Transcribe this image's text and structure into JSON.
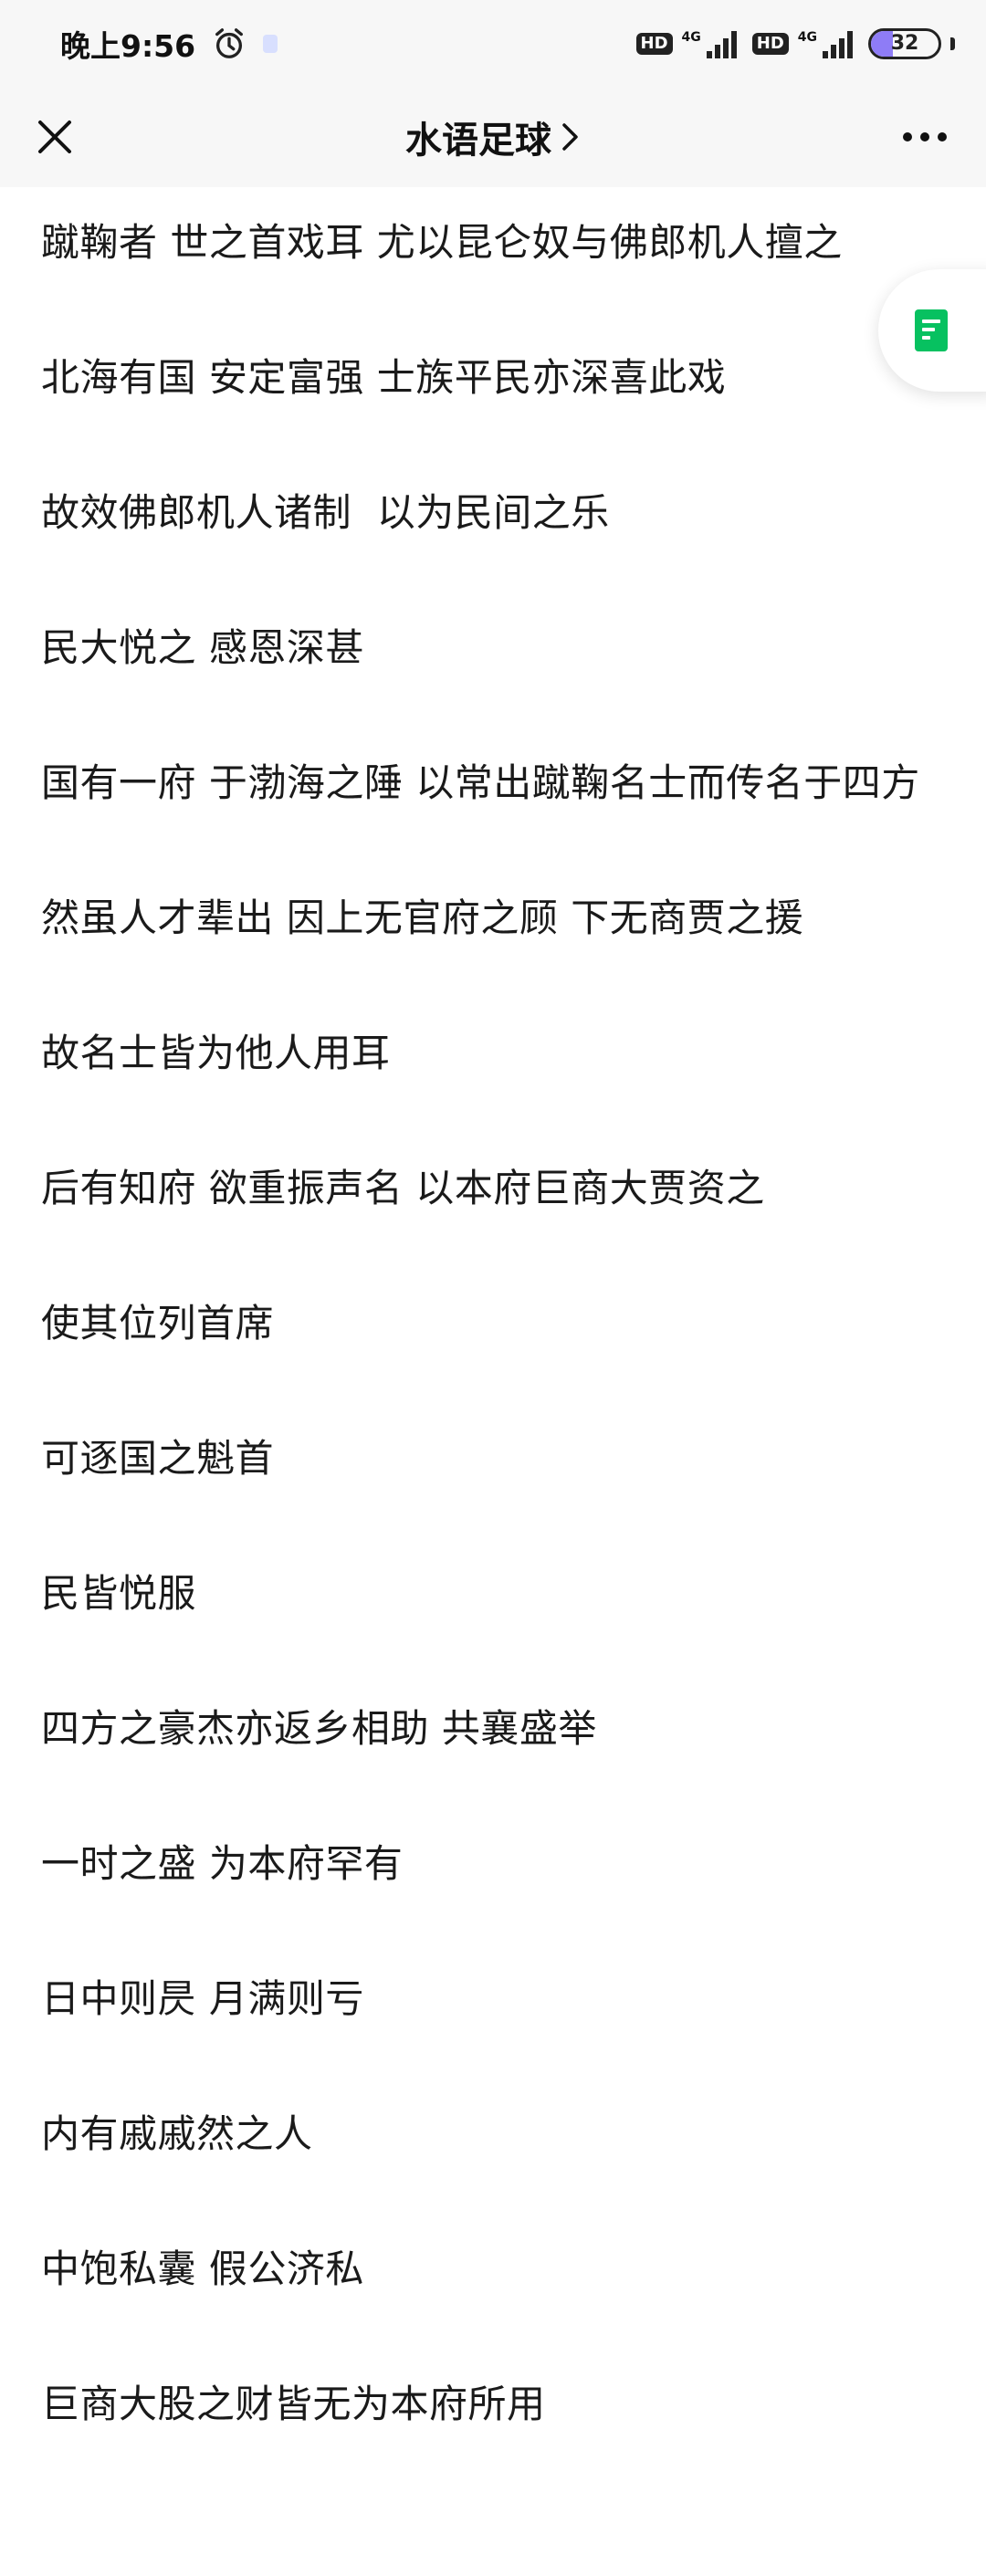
{
  "status_bar": {
    "time": "晚上9:56",
    "hd_badge": "HD",
    "network_1": "4G",
    "network_2": "4G",
    "battery_level": "32",
    "battery_fraction": 0.32,
    "icons": [
      "alarm-icon",
      "notification-icon",
      "signal-icon",
      "battery-icon"
    ]
  },
  "nav": {
    "title": "水语足球",
    "icons": [
      "close-icon",
      "chevron-right-icon",
      "more-icon"
    ]
  },
  "article": {
    "lines": [
      "蹴鞠者 世之首戏耳 尤以昆仑奴与佛郎机人擅之",
      "北海有国 安定富强 士族平民亦深喜此戏",
      "故效佛郎机人诸制  以为民间之乐",
      "民大悦之 感恩深甚",
      "国有一府 于渤海之陲 以常出蹴鞠名士而传名于四方",
      "然虽人才辈出 因上无官府之顾 下无商贾之援",
      "故名士皆为他人用耳",
      "后有知府 欲重振声名 以本府巨商大贾资之",
      "使其位列首席",
      "可逐国之魁首",
      "民皆悦服",
      "四方之豪杰亦返乡相助 共襄盛举",
      "一时之盛 为本府罕有",
      "日中则昃 月满则亏",
      "内有戚戚然之人",
      "中饱私囊 假公济私",
      "巨商大股之财皆无为本府所用"
    ]
  },
  "floating_button": {
    "icon": "document-icon",
    "color": "#07c160"
  },
  "colors": {
    "background": "#ffffff",
    "bar_background": "#f7f7f7",
    "text": "#1a1a1a",
    "battery_fill": "#8e7cf6"
  }
}
